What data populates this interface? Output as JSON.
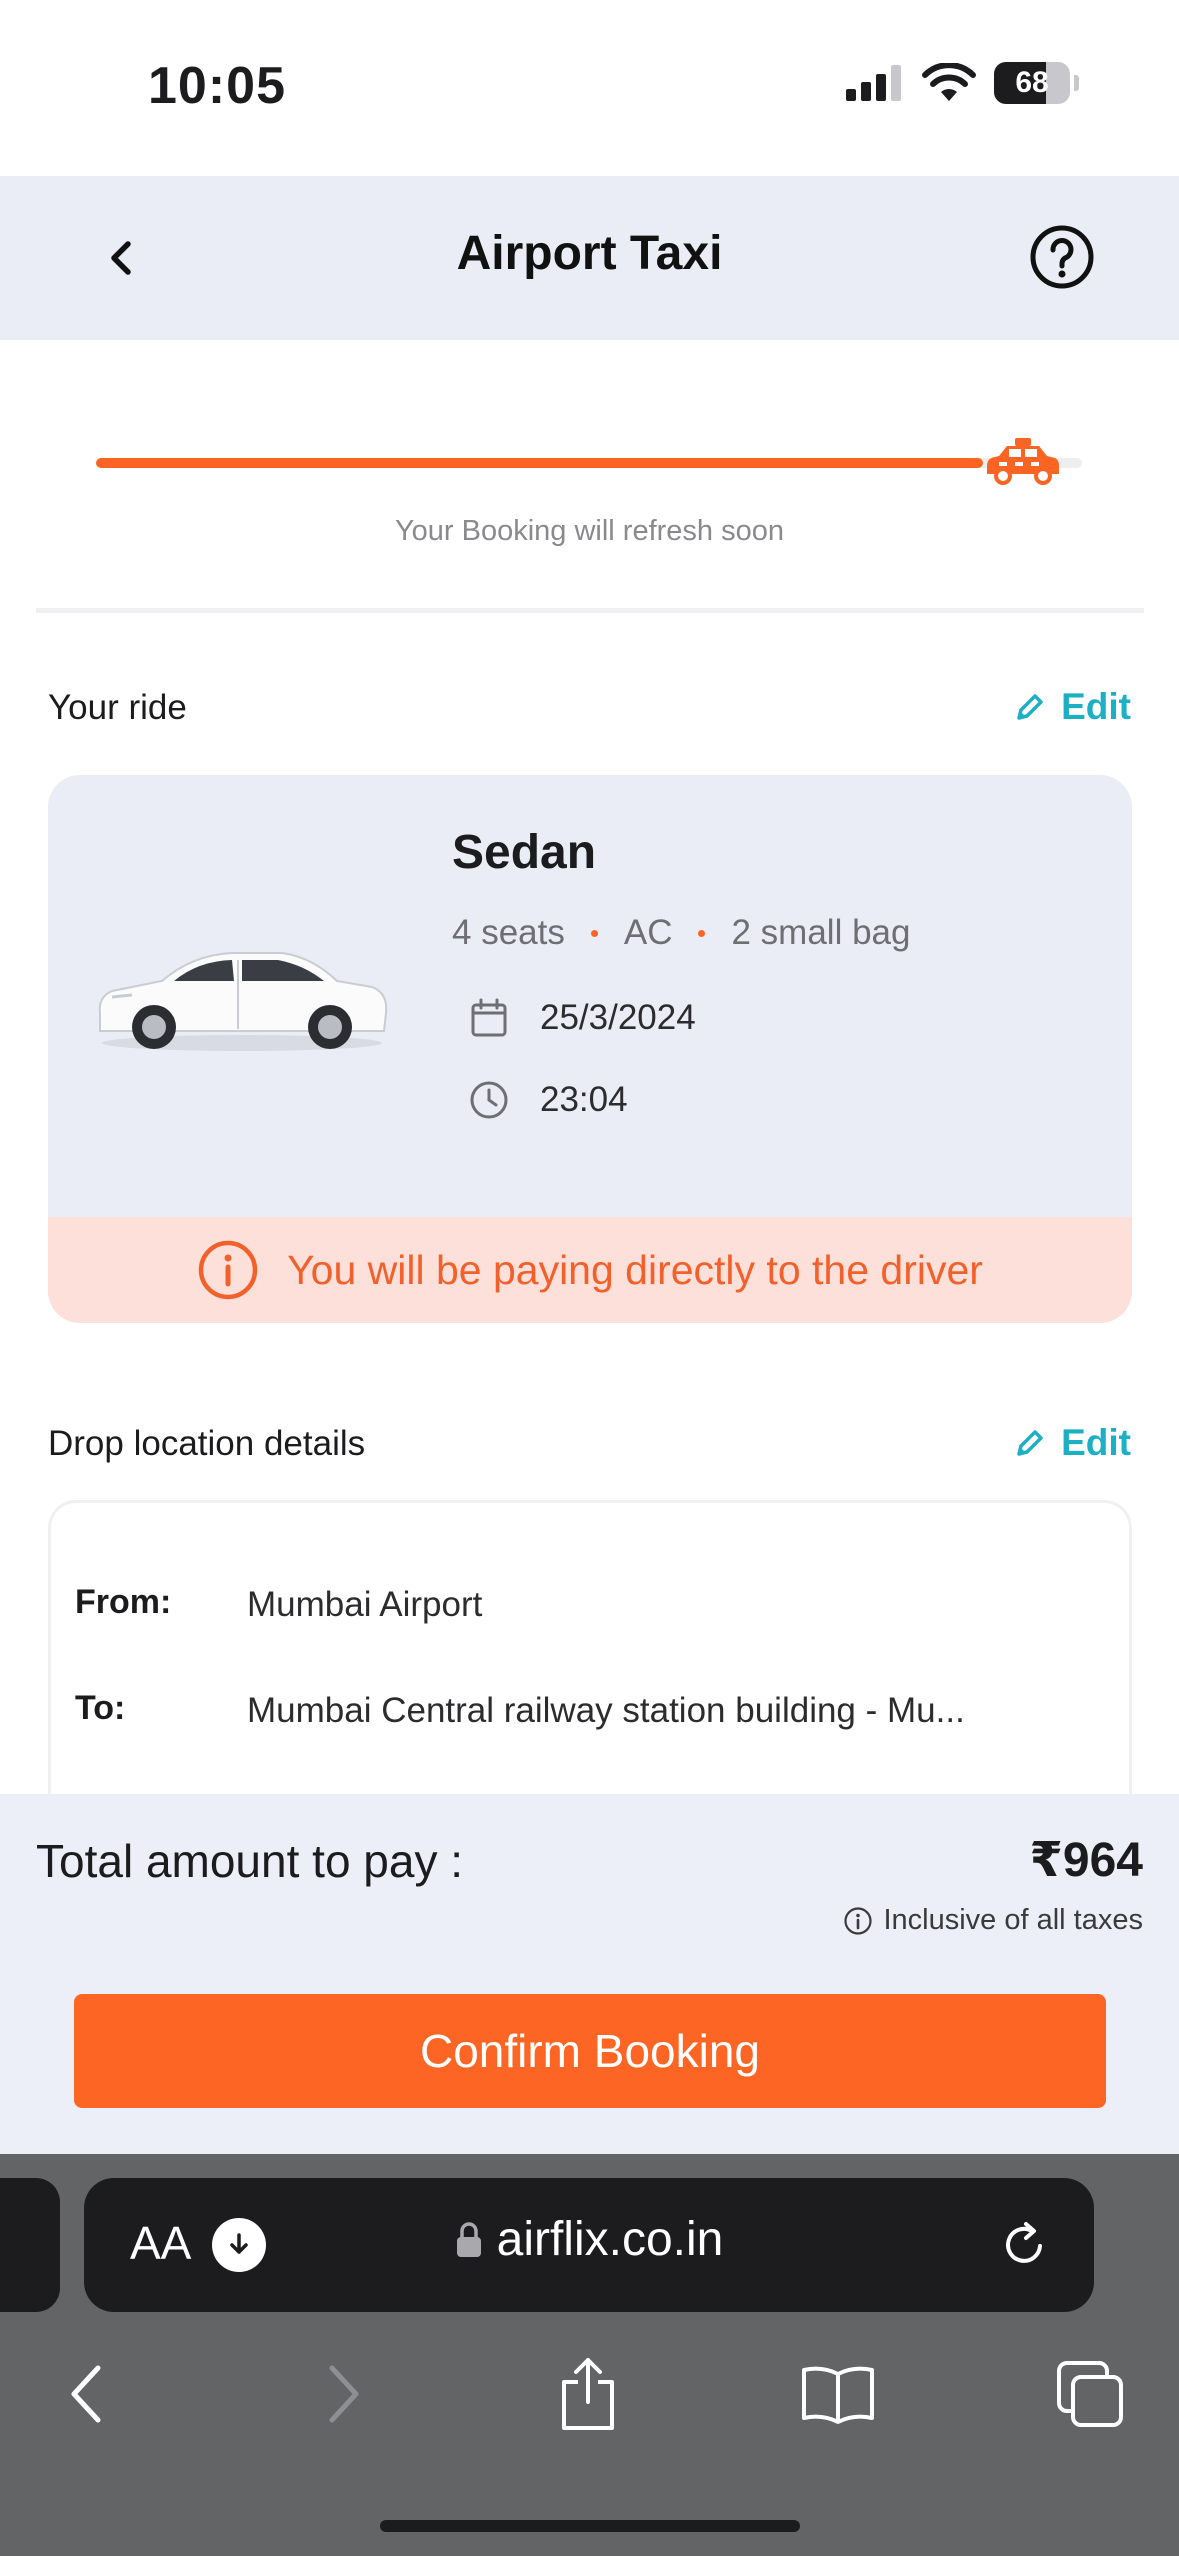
{
  "status_bar": {
    "time": "10:05",
    "battery": "68"
  },
  "header": {
    "title": "Airport Taxi"
  },
  "progress": {
    "fraction": 0.9,
    "note": "Your Booking will refresh soon"
  },
  "ride_section": {
    "title": "Your ride",
    "edit_label": "Edit"
  },
  "ride": {
    "car_name": "Sedan",
    "features": [
      "4 seats",
      "AC",
      "2 small bag"
    ],
    "date": "25/3/2024",
    "time": "23:04",
    "payment_notice": "You will be paying directly to the driver"
  },
  "drop_section": {
    "title": "Drop location details",
    "edit_label": "Edit"
  },
  "locations": {
    "from_label": "From:",
    "from_value": "Mumbai Airport",
    "to_label": "To:",
    "to_value": "Mumbai Central railway station building - Mu..."
  },
  "footer": {
    "total_label": "Total amount to pay :",
    "total_amount": "₹964",
    "tax_note": "Inclusive of all taxes",
    "confirm_label": "Confirm Booking"
  },
  "browser": {
    "aa_label": "AA",
    "url": "airflix.co.in"
  },
  "colors": {
    "accent": "#fb6422",
    "edit": "#1db0c5",
    "card_bg": "#eaedf6",
    "banner_bg": "#fde0d9"
  },
  "icons": [
    "chevron-left-icon",
    "help-circle-icon",
    "taxi-icon",
    "pencil-icon",
    "calendar-icon",
    "clock-icon",
    "info-icon",
    "lock-icon",
    "reload-icon",
    "share-icon",
    "bookmarks-icon",
    "tabs-icon"
  ]
}
